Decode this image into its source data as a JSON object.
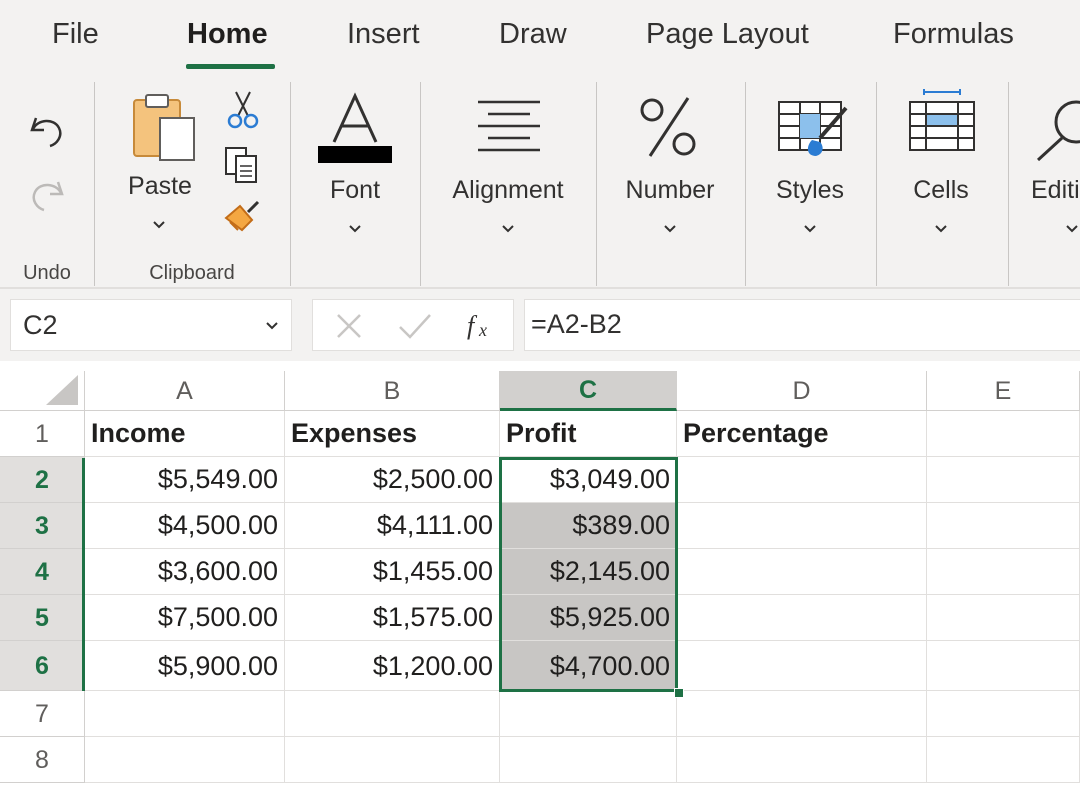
{
  "tabs": [
    {
      "label": "File"
    },
    {
      "label": "Home"
    },
    {
      "label": "Insert"
    },
    {
      "label": "Draw"
    },
    {
      "label": "Page Layout"
    },
    {
      "label": "Formulas"
    }
  ],
  "active_tab": "Home",
  "ribbon": {
    "paste_label": "Paste",
    "font_label": "Font",
    "alignment_label": "Alignment",
    "number_label": "Number",
    "styles_label": "Styles",
    "cells_label": "Cells",
    "editing_label": "Editi",
    "groups": {
      "undo": "Undo",
      "clipboard": "Clipboard"
    }
  },
  "formula_bar": {
    "name_box": "C2",
    "formula": "=A2-B2"
  },
  "grid": {
    "column_headers": [
      "A",
      "B",
      "C",
      "D",
      "E"
    ],
    "selected_column": "C",
    "row_headers": [
      "1",
      "2",
      "3",
      "4",
      "5",
      "6",
      "7",
      "8"
    ],
    "highlighted_rows": [
      "2",
      "3",
      "4",
      "5",
      "6"
    ],
    "header_row": [
      "Income",
      "Expenses",
      "Profit",
      "Percentage"
    ],
    "rows": [
      [
        "$5,549.00",
        "$2,500.00",
        "$3,049.00"
      ],
      [
        "$4,500.00",
        "$4,111.00",
        "$389.00"
      ],
      [
        "$3,600.00",
        "$1,455.00",
        "$2,145.00"
      ],
      [
        "$7,500.00",
        "$1,575.00",
        "$5,925.00"
      ],
      [
        "$5,900.00",
        "$1,200.00",
        "$4,700.00"
      ]
    ]
  },
  "colors": {
    "accent_green": "#1e7145",
    "selection_fill": "#c8c6c4",
    "ribbon_bg": "#f3f2f1"
  }
}
